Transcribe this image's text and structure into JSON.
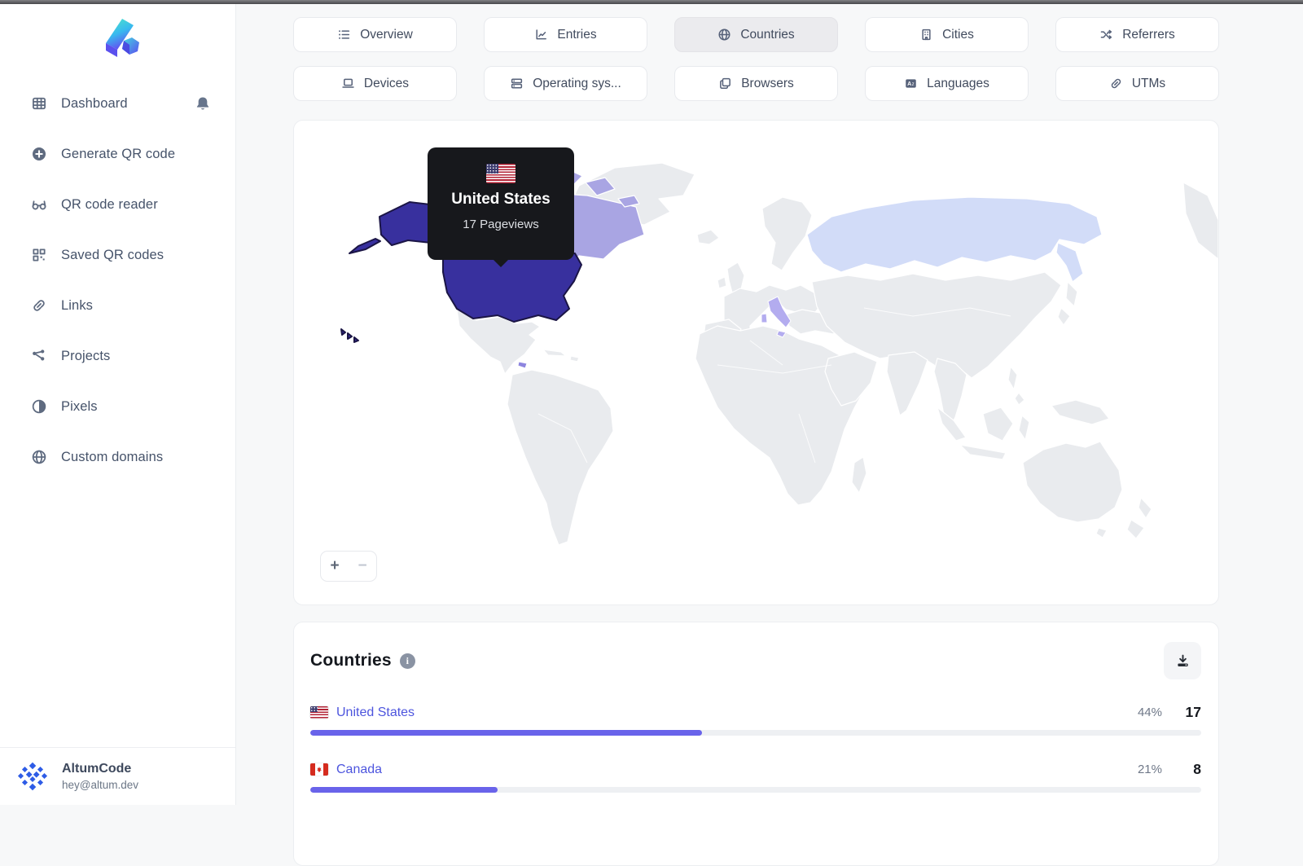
{
  "sidebar": {
    "logo_name": "altumcode-logo",
    "items": [
      {
        "label": "Dashboard",
        "icon": "grid-icon"
      },
      {
        "label": "Generate QR code",
        "icon": "plus-circle-icon"
      },
      {
        "label": "QR code reader",
        "icon": "glasses-icon"
      },
      {
        "label": "Saved QR codes",
        "icon": "qr-code-icon"
      },
      {
        "label": "Links",
        "icon": "link-icon"
      },
      {
        "label": "Projects",
        "icon": "share-nodes-icon"
      },
      {
        "label": "Pixels",
        "icon": "half-circle-icon"
      },
      {
        "label": "Custom domains",
        "icon": "globe-icon"
      }
    ],
    "notification_icon": "bell-icon",
    "user": {
      "name": "AltumCode",
      "email": "hey@altum.dev"
    }
  },
  "tabs": [
    {
      "label": "Overview",
      "icon": "list-icon"
    },
    {
      "label": "Entries",
      "icon": "chart-icon"
    },
    {
      "label": "Countries",
      "icon": "globe-icon",
      "active": true
    },
    {
      "label": "Cities",
      "icon": "building-icon"
    },
    {
      "label": "Referrers",
      "icon": "shuffle-icon"
    },
    {
      "label": "Devices",
      "icon": "laptop-icon"
    },
    {
      "label": "Operating sys...",
      "icon": "server-icon"
    },
    {
      "label": "Browsers",
      "icon": "browser-icon"
    },
    {
      "label": "Languages",
      "icon": "language-icon"
    },
    {
      "label": "UTMs",
      "icon": "link-icon"
    }
  ],
  "map": {
    "tooltip": {
      "country": "United States",
      "value": "17 Pageviews",
      "flag": "us-flag-icon"
    },
    "zoom_in": "+",
    "zoom_out": "−",
    "base_color": "#e9ebee",
    "highlight_colors": {
      "united_states": "#38309e",
      "united_states_stroke": "#1b1545",
      "canada": "#a9a5e3",
      "russia": "#d2dcf8",
      "italy": "#b3acef",
      "panama": "#8d85df"
    }
  },
  "countries_panel": {
    "title": "Countries",
    "rows": [
      {
        "country": "United States",
        "flag": "us",
        "percent": "44%",
        "count": "17"
      },
      {
        "country": "Canada",
        "flag": "ca",
        "percent": "21%",
        "count": "8"
      }
    ]
  },
  "chart_data": {
    "type": "bar",
    "title": "Countries pageviews",
    "categories": [
      "United States",
      "Canada"
    ],
    "values": [
      17,
      8
    ],
    "percents": [
      44,
      21
    ]
  }
}
